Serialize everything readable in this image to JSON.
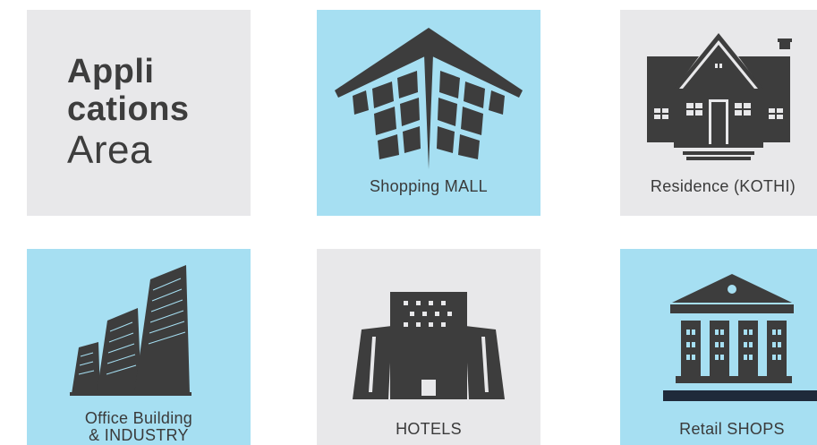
{
  "heading": {
    "line1": "Appli",
    "line2": "cations",
    "line3": "Area"
  },
  "tiles": [
    {
      "label": "Shopping MALL",
      "icon": "shopping-mall-icon"
    },
    {
      "label": "Residence (KOTHI)",
      "icon": "residence-house-icon"
    },
    {
      "label_line1": "Office Building",
      "label_line2": "& INDUSTRY",
      "icon": "office-buildings-icon"
    },
    {
      "label": "HOTELS",
      "icon": "hotel-building-icon"
    },
    {
      "label": "Retail SHOPS",
      "icon": "retail-shop-icon"
    }
  ],
  "colors": {
    "tile_grey": "#e8e8ea",
    "tile_blue": "#a6dff2",
    "icon_dark": "#3d3d3d",
    "text": "#3a3a3a",
    "shop_base": "#1f2a3a"
  }
}
